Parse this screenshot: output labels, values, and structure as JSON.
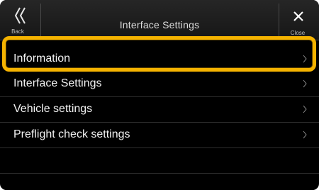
{
  "header": {
    "title": "Interface Settings",
    "back_label": "Back",
    "close_label": "Close"
  },
  "menu": {
    "items": [
      {
        "label": "Information",
        "selected": true
      },
      {
        "label": "Interface Settings",
        "selected": false
      },
      {
        "label": "Vehicle settings",
        "selected": false
      },
      {
        "label": "Preflight check settings",
        "selected": false
      }
    ]
  },
  "colors": {
    "background": "#000000",
    "header": "#1e1e1e",
    "text": "#f2f2f2",
    "highlight": "#f5b300"
  },
  "icons": {
    "back": "double-chevron-left-icon",
    "close": "close-icon",
    "row_arrow": "chevron-right-icon"
  }
}
